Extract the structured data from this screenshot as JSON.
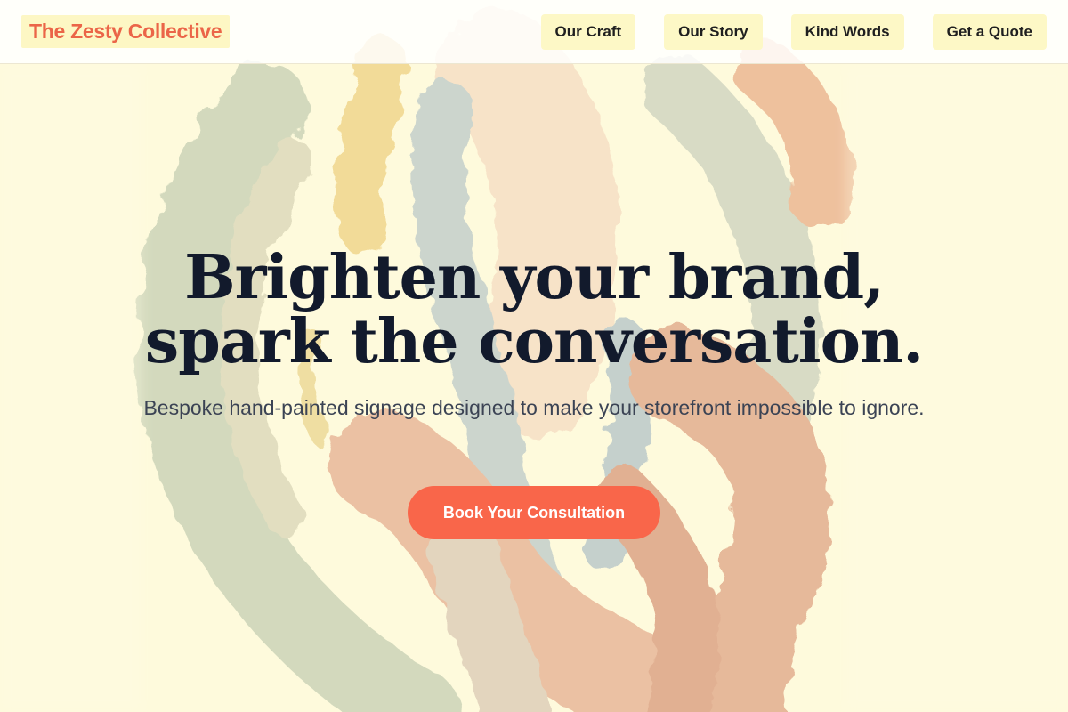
{
  "brand": {
    "name": "The Zesty Collective"
  },
  "nav": {
    "items": [
      {
        "label": "Our Craft"
      },
      {
        "label": "Our Story"
      },
      {
        "label": "Kind Words"
      },
      {
        "label": "Get a Quote"
      }
    ]
  },
  "hero": {
    "headline_line1": "Brighten your brand,",
    "headline_line2": "spark the conversation.",
    "subheadline": "Bespoke hand-painted signage designed to make your storefront impossible to ignore.",
    "cta_label": "Book Your Consultation"
  },
  "colors": {
    "accent": "#f9664a",
    "logo_text": "#eb6548",
    "nav_button_bg": "#fdf8c6",
    "page_bg": "#fefbdc",
    "headline": "#121a2c",
    "body_text": "#3b4354"
  }
}
